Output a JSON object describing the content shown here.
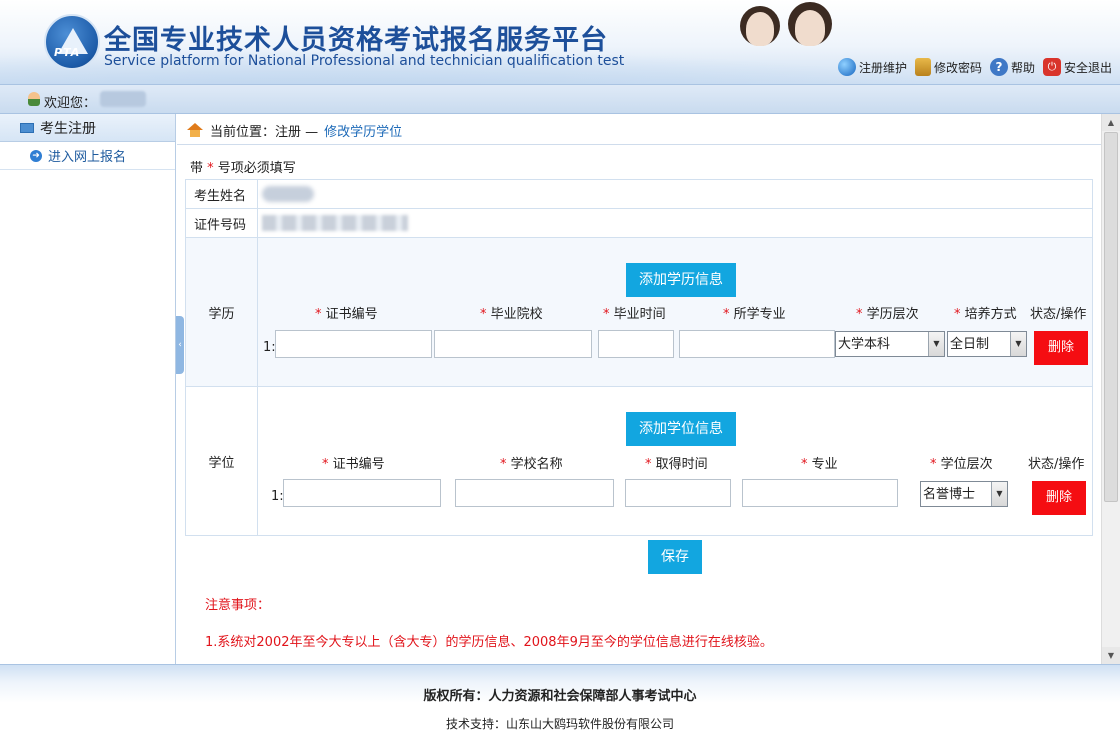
{
  "header": {
    "title": "全国专业技术人员资格考试报名服务平台",
    "subtitle": "Service platform for National Professional and technician qualification test",
    "logo_text": "PTA",
    "links": {
      "account": "注册维护",
      "password": "修改密码",
      "help": "帮助",
      "logout": "安全退出"
    }
  },
  "welcome": {
    "label": "欢迎您："
  },
  "sidebar": {
    "section_title": "考生注册",
    "items": [
      {
        "label": "进入网上报名"
      }
    ]
  },
  "breadcrumb": {
    "prefix": "当前位置：注册 —",
    "current": "修改学历学位"
  },
  "form": {
    "required_note_prefix": "带",
    "required_note_star": "*",
    "required_note_suffix": "号项必须填写",
    "name_label": "考生姓名",
    "id_label": "证件号码",
    "education": {
      "label": "学历",
      "add_button": "添加学历信息",
      "columns": [
        "证书编号",
        "毕业院校",
        "毕业时间",
        "所学专业",
        "学历层次",
        "培养方式"
      ],
      "status_col": "状态/操作",
      "row_number": "1:",
      "level_value": "大学本科",
      "mode_value": "全日制",
      "delete_button": "删除"
    },
    "degree": {
      "label": "学位",
      "add_button": "添加学位信息",
      "columns": [
        "证书编号",
        "学校名称",
        "取得时间",
        "专业",
        "学位层次"
      ],
      "status_col": "状态/操作",
      "row_number": "1:",
      "level_value": "名誉博士",
      "delete_button": "删除"
    },
    "save_button": "保存"
  },
  "notes": {
    "title": "注意事项：",
    "items": [
      "1.系统对2002年至今大专以上（含大专）的学历信息、2008年9月至今的学位信息进行在线核验。"
    ]
  },
  "footer": {
    "copyright": "版权所有：人力资源和社会保障部人事考试中心",
    "support": "技术支持：山东山大鸥玛软件股份有限公司"
  }
}
